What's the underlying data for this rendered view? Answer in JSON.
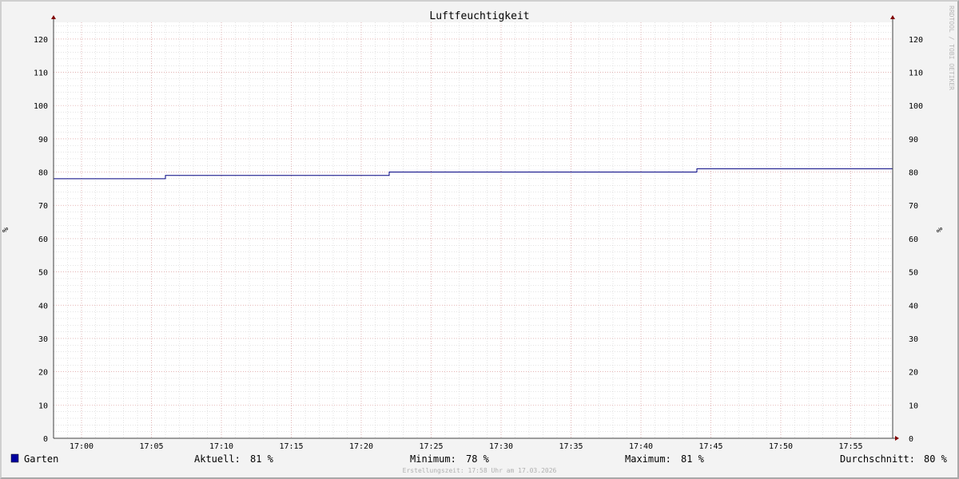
{
  "chart_data": {
    "type": "line",
    "title": "Luftfeuchtigkeit",
    "ylabel": "%",
    "ylabel_right": "%",
    "ylim": [
      0,
      125
    ],
    "yticks": [
      0,
      10,
      20,
      30,
      40,
      50,
      60,
      70,
      80,
      90,
      100,
      110,
      120
    ],
    "xlim": [
      "16:58",
      "17:58"
    ],
    "xticks": [
      "17:00",
      "17:05",
      "17:10",
      "17:15",
      "17:20",
      "17:25",
      "17:30",
      "17:35",
      "17:40",
      "17:45",
      "17:50",
      "17:55"
    ],
    "grid": true,
    "series": [
      {
        "name": "Garten",
        "color": "#000080",
        "legend_color": "#0000a0",
        "points": [
          [
            "16:58",
            78
          ],
          [
            "17:06",
            78
          ],
          [
            "17:06",
            79
          ],
          [
            "17:22",
            79
          ],
          [
            "17:22",
            80
          ],
          [
            "17:44",
            80
          ],
          [
            "17:44",
            81
          ],
          [
            "17:58",
            81
          ]
        ]
      }
    ],
    "watermark": "RRDTOOL / TOBI OETIKER",
    "colors": {
      "background": "#f3f3f3",
      "plot": "#ffffff",
      "minor_grid": "#c8c8c8",
      "major_grid": "#e0a0a0",
      "axis": "#404040",
      "arrow": "#800000"
    }
  },
  "legend": {
    "series_name": "Garten",
    "stats": [
      {
        "label": "Aktuell:",
        "value": "81 %"
      },
      {
        "label": "Minimum:",
        "value": "78 %"
      },
      {
        "label": "Maximum:",
        "value": "81 %"
      },
      {
        "label": "Durchschnitt:",
        "value": "80 %"
      }
    ]
  },
  "footer": "Erstellungszeit: 17:58 Uhr am 17.03.2026"
}
